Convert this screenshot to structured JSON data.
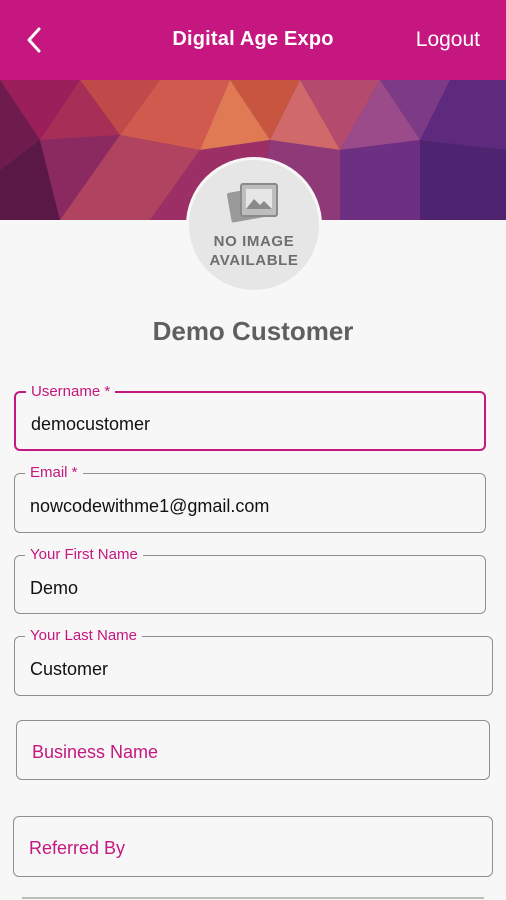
{
  "appbar": {
    "title": "Digital Age Expo",
    "logout_label": "Logout",
    "back_icon": "chevron-left-icon",
    "background": "#c5177f"
  },
  "profile": {
    "avatar_text": "NO IMAGE\nAVAILABLE",
    "avatar_icon": "photo-placeholder-icon",
    "name": "Demo Customer"
  },
  "form": {
    "username": {
      "label": "Username *",
      "value": "democustomer"
    },
    "email": {
      "label": "Email *",
      "value": "nowcodewithme1@gmail.com"
    },
    "first_name": {
      "label": "Your First Name",
      "value": "Demo"
    },
    "last_name": {
      "label": "Your Last Name",
      "value": "Customer"
    },
    "business_name": {
      "placeholder": "Business Name"
    },
    "referred_by": {
      "placeholder": "Referred By"
    }
  },
  "colors": {
    "accent": "#c5177f",
    "text": "#111111",
    "muted": "#5f5f5f",
    "border": "#8f8f8f"
  }
}
